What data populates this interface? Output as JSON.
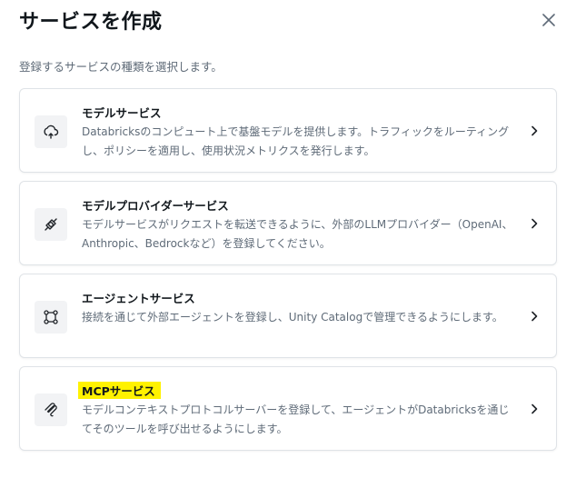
{
  "dialog": {
    "title": "サービスを作成",
    "subtitle": "登録するサービスの種類を選択します。",
    "close_icon": "close-icon"
  },
  "services": [
    {
      "icon": "model-serving-icon",
      "name": "モデルサービス",
      "description": "Databricksのコンピュート上で基盤モデルを提供します。トラフィックをルーティングし、ポリシーを適用し、使用状況メトリクスを発行します。"
    },
    {
      "icon": "plug-icon",
      "name": "モデルプロバイダーサービス",
      "description": "モデルサービスがリクエストを転送できるように、外部のLLMプロバイダー（OpenAI、Anthropic、Bedrockなど）を登録してください。"
    },
    {
      "icon": "agent-icon",
      "name": "エージェントサービス",
      "description": "接続を通じて外部エージェントを登録し、Unity Catalogで管理できるようにします。"
    },
    {
      "icon": "mcp-icon",
      "name": "MCPサービス",
      "description": "モデルコンテキストプロトコルサーバーを登録して、エージェントがDatabricksを通じてそのツールを呼び出せるようにします。"
    }
  ],
  "colors": {
    "highlight": "#fff200",
    "border": "#dfe3e7",
    "muted_text": "#5f6b78"
  }
}
